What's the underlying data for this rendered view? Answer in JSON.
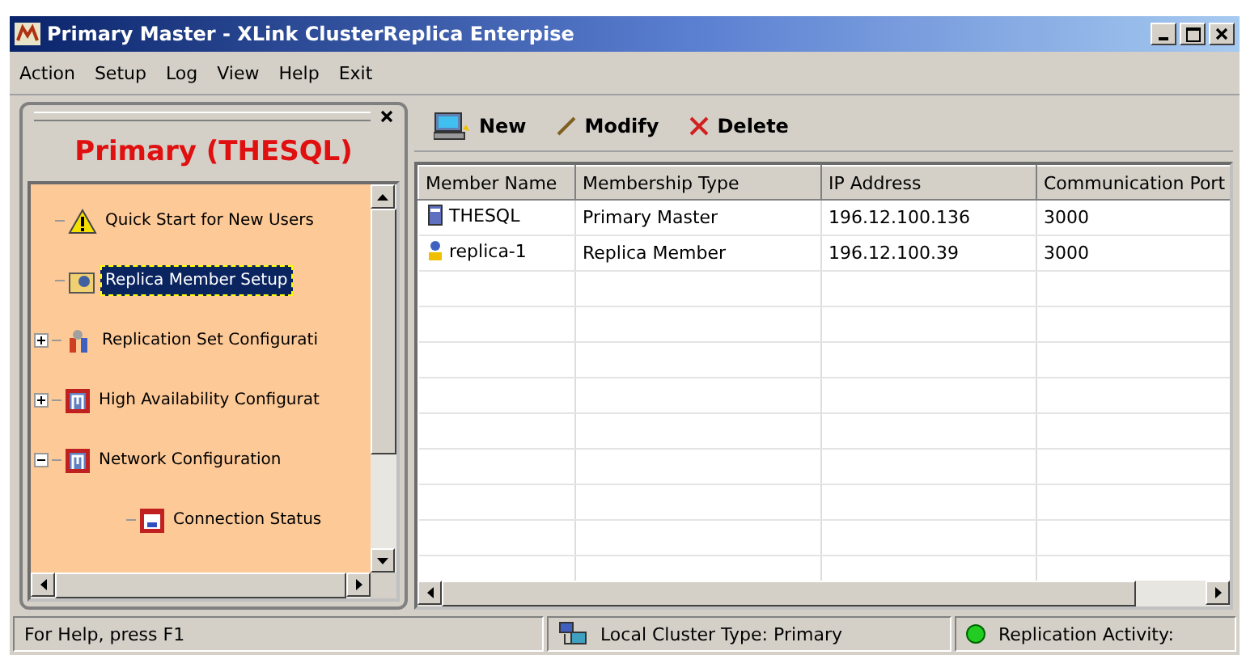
{
  "window": {
    "title": "Primary Master - XLink ClusterReplica Enterpise"
  },
  "menu": [
    "Action",
    "Setup",
    "Log",
    "View",
    "Help",
    "Exit"
  ],
  "sidebar": {
    "title": "Primary (THESQL)",
    "items": [
      {
        "label": "Quick Start for New Users",
        "kind": "warning",
        "expandable": false,
        "selected": false
      },
      {
        "label": "Replica Member Setup",
        "kind": "setup",
        "expandable": false,
        "selected": true
      },
      {
        "label": "Replication Set Configurati",
        "kind": "tools",
        "expandable": true,
        "expanded": false,
        "selected": false
      },
      {
        "label": "High Availability Configurat",
        "kind": "network",
        "expandable": true,
        "expanded": false,
        "selected": false
      },
      {
        "label": "Network Configuration",
        "kind": "network",
        "expandable": true,
        "expanded": true,
        "selected": false,
        "children": [
          {
            "label": "Connection Status",
            "kind": "status",
            "expandable": false,
            "selected": false
          }
        ]
      }
    ]
  },
  "toolbar": [
    {
      "label": "New",
      "kind": "new"
    },
    {
      "label": "Modify",
      "kind": "modify"
    },
    {
      "label": "Delete",
      "kind": "delete"
    }
  ],
  "table": {
    "columns": [
      "Member Name",
      "Membership Type",
      "IP Address",
      "Communication Port"
    ],
    "rows": [
      {
        "kind": "master",
        "cells": [
          "THESQL",
          "Primary Master",
          "196.12.100.136",
          "3000"
        ]
      },
      {
        "kind": "member",
        "cells": [
          "replica-1",
          "Replica Member",
          "196.12.100.39",
          "3000"
        ]
      }
    ]
  },
  "status_bar": {
    "help": "For Help, press F1",
    "cluster": "Local Cluster Type: Primary",
    "activity": "Replication Activity:",
    "activity_on": true
  }
}
